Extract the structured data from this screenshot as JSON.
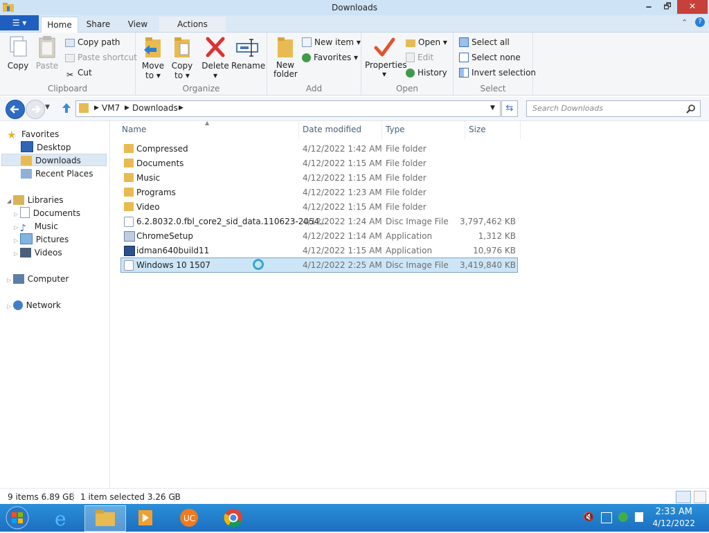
{
  "window": {
    "title": "Downloads",
    "minimize": "🗕",
    "restore": "🗗",
    "close": "✕"
  },
  "ribbon_tabs": {
    "file": "☰ ▾",
    "home": "Home",
    "share": "Share",
    "view": "View",
    "actions": "Actions"
  },
  "ribbon": {
    "clipboard": {
      "copy": "Copy",
      "paste": "Paste",
      "copy_path": "Copy path",
      "paste_shortcut": "Paste shortcut",
      "cut": "Cut",
      "label": "Clipboard"
    },
    "organize": {
      "move_to": "Move to ▾",
      "copy_to": "Copy to ▾",
      "delete": "Delete ▾",
      "rename": "Rename",
      "label": "Organize"
    },
    "new": {
      "new_folder": "New folder",
      "new_item": "New item ▾",
      "favorites": "Favorites ▾",
      "label": "Add"
    },
    "open": {
      "properties": "Properties ▾",
      "open": "Open ▾",
      "edit": "Edit",
      "history": "History",
      "label": "Open"
    },
    "select": {
      "select_all": "Select all",
      "select_none": "Select none",
      "invert": "Invert selection",
      "label": "Select"
    }
  },
  "address": {
    "crumbs": [
      "VM7",
      "Downloads"
    ],
    "search_placeholder": "Search Downloads"
  },
  "nav": {
    "favorites": "Favorites",
    "desktop": "Desktop",
    "downloads": "Downloads",
    "recent": "Recent Places",
    "libraries": "Libraries",
    "documents": "Documents",
    "music": "Music",
    "pictures": "Pictures",
    "videos": "Videos",
    "computer": "Computer",
    "network": "Network"
  },
  "columns": {
    "name": "Name",
    "date": "Date modified",
    "type": "Type",
    "size": "Size"
  },
  "files": [
    {
      "name": "Compressed",
      "date": "4/12/2022 1:42 AM",
      "type": "File folder",
      "size": "",
      "icon": "folder-icon"
    },
    {
      "name": "Documents",
      "date": "4/12/2022 1:15 AM",
      "type": "File folder",
      "size": "",
      "icon": "folder-icon"
    },
    {
      "name": "Music",
      "date": "4/12/2022 1:15 AM",
      "type": "File folder",
      "size": "",
      "icon": "folder-icon"
    },
    {
      "name": "Programs",
      "date": "4/12/2022 1:23 AM",
      "type": "File folder",
      "size": "",
      "icon": "folder-icon"
    },
    {
      "name": "Video",
      "date": "4/12/2022 1:15 AM",
      "type": "File folder",
      "size": "",
      "icon": "folder-icon"
    },
    {
      "name": "6.2.8032.0.fbl_core2_sid_data.110623-2054...",
      "date": "4/12/2022 1:24 AM",
      "type": "Disc Image File",
      "size": "3,797,462 KB",
      "icon": "disc-image-icon"
    },
    {
      "name": "ChromeSetup",
      "date": "4/12/2022 1:14 AM",
      "type": "Application",
      "size": "1,312 KB",
      "icon": "chrome-icon"
    },
    {
      "name": "idman640build11",
      "date": "4/12/2022 1:15 AM",
      "type": "Application",
      "size": "10,976 KB",
      "icon": "idm-icon"
    },
    {
      "name": "Windows 10 1507",
      "date": "4/12/2022 2:25 AM",
      "type": "Disc Image File",
      "size": "3,419,840 KB",
      "icon": "disc-image-icon",
      "selected": true
    }
  ],
  "status": {
    "items": "9 items  6.89 GB",
    "selected": "1 item selected  3.26 GB"
  },
  "taskbar": {
    "time": "2:33 AM",
    "date": "4/12/2022"
  },
  "colors": {
    "accent": "#1f5fbf",
    "taskbar": "#1b6fc0",
    "selection": "#cde6f7"
  }
}
